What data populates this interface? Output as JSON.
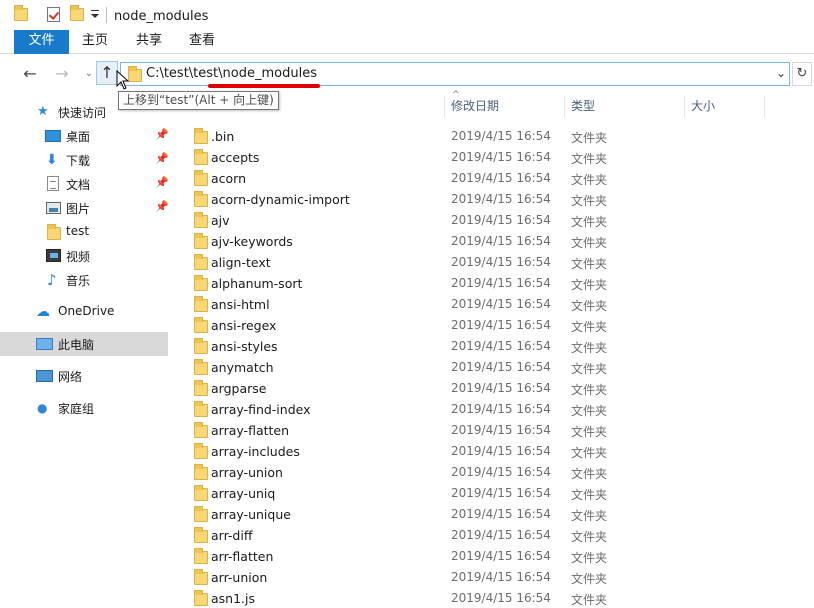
{
  "window": {
    "title": "node_modules"
  },
  "ribbon": {
    "file": "文件",
    "home": "主页",
    "share": "共享",
    "view": "查看"
  },
  "address": {
    "path": "C:\\test\\test\\node_modules",
    "tooltip": "上移到“test”(Alt + 向上键)"
  },
  "nav_icons": {
    "back": "arrow-left-icon",
    "forward": "arrow-right-icon",
    "recent": "chevron-down-icon",
    "up": "arrow-up-icon",
    "refresh": "refresh-icon"
  },
  "sidebar": {
    "quick_access": "快速访问",
    "items": [
      {
        "label": "桌面",
        "icon": "desktop-icon",
        "pinned": true
      },
      {
        "label": "下载",
        "icon": "download-icon",
        "pinned": true
      },
      {
        "label": "文档",
        "icon": "document-icon",
        "pinned": true
      },
      {
        "label": "图片",
        "icon": "picture-icon",
        "pinned": true
      },
      {
        "label": "test",
        "icon": "folder-icon",
        "pinned": false
      },
      {
        "label": "视频",
        "icon": "video-icon",
        "pinned": false
      },
      {
        "label": "音乐",
        "icon": "music-icon",
        "pinned": false
      }
    ],
    "onedrive": "OneDrive",
    "this_pc": "此电脑",
    "network": "网络",
    "homegroup": "家庭组"
  },
  "columns": {
    "name": "",
    "date": "修改日期",
    "type": "类型",
    "size": "大小"
  },
  "files": [
    {
      "name": ".bin",
      "date": "2019/4/15 16:54",
      "type": "文件夹"
    },
    {
      "name": "accepts",
      "date": "2019/4/15 16:54",
      "type": "文件夹"
    },
    {
      "name": "acorn",
      "date": "2019/4/15 16:54",
      "type": "文件夹"
    },
    {
      "name": "acorn-dynamic-import",
      "date": "2019/4/15 16:54",
      "type": "文件夹"
    },
    {
      "name": "ajv",
      "date": "2019/4/15 16:54",
      "type": "文件夹"
    },
    {
      "name": "ajv-keywords",
      "date": "2019/4/15 16:54",
      "type": "文件夹"
    },
    {
      "name": "align-text",
      "date": "2019/4/15 16:54",
      "type": "文件夹"
    },
    {
      "name": "alphanum-sort",
      "date": "2019/4/15 16:54",
      "type": "文件夹"
    },
    {
      "name": "ansi-html",
      "date": "2019/4/15 16:54",
      "type": "文件夹"
    },
    {
      "name": "ansi-regex",
      "date": "2019/4/15 16:54",
      "type": "文件夹"
    },
    {
      "name": "ansi-styles",
      "date": "2019/4/15 16:54",
      "type": "文件夹"
    },
    {
      "name": "anymatch",
      "date": "2019/4/15 16:54",
      "type": "文件夹"
    },
    {
      "name": "argparse",
      "date": "2019/4/15 16:54",
      "type": "文件夹"
    },
    {
      "name": "array-find-index",
      "date": "2019/4/15 16:54",
      "type": "文件夹"
    },
    {
      "name": "array-flatten",
      "date": "2019/4/15 16:54",
      "type": "文件夹"
    },
    {
      "name": "array-includes",
      "date": "2019/4/15 16:54",
      "type": "文件夹"
    },
    {
      "name": "array-union",
      "date": "2019/4/15 16:54",
      "type": "文件夹"
    },
    {
      "name": "array-uniq",
      "date": "2019/4/15 16:54",
      "type": "文件夹"
    },
    {
      "name": "array-unique",
      "date": "2019/4/15 16:54",
      "type": "文件夹"
    },
    {
      "name": "arr-diff",
      "date": "2019/4/15 16:54",
      "type": "文件夹"
    },
    {
      "name": "arr-flatten",
      "date": "2019/4/15 16:54",
      "type": "文件夹"
    },
    {
      "name": "arr-union",
      "date": "2019/4/15 16:54",
      "type": "文件夹"
    },
    {
      "name": "asn1.js",
      "date": "2019/4/15 16:54",
      "type": "文件夹"
    }
  ],
  "colors": {
    "accent": "#1979ca",
    "selected": "#d9d9d9",
    "annotation": "#e00000",
    "folder": "#f8d775"
  }
}
